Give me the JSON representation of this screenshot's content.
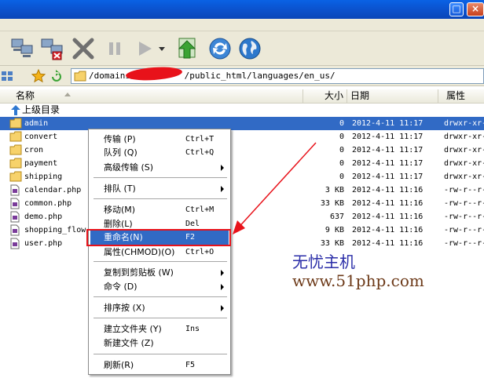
{
  "window": {
    "maximize_glyph": "□",
    "close_glyph": "×"
  },
  "toolbar": {
    "icons": [
      "connect-icon",
      "disconnect-icon",
      "cancel-icon",
      "pause-icon",
      "play-icon",
      "play-dropdown-icon",
      "transfer-icon",
      "refresh-icon",
      "globe-icon"
    ]
  },
  "address": {
    "path_prefix": "/domains/",
    "path_suffix": "/public_html/languages/en_us/"
  },
  "columns": {
    "name": "名称",
    "size": "大小",
    "date": "日期",
    "attr": "属性"
  },
  "files": [
    {
      "name": "上级目录",
      "size": "",
      "date": "",
      "attr": "",
      "type": "up"
    },
    {
      "name": "admin",
      "size": "0",
      "date": "2012-4-11 11:17",
      "attr": "drwxr-xr-x",
      "type": "folder",
      "selected": true
    },
    {
      "name": "convert",
      "size": "0",
      "date": "2012-4-11 11:17",
      "attr": "drwxr-xr-x",
      "type": "folder"
    },
    {
      "name": "cron",
      "size": "0",
      "date": "2012-4-11 11:17",
      "attr": "drwxr-xr-x",
      "type": "folder"
    },
    {
      "name": "payment",
      "size": "0",
      "date": "2012-4-11 11:17",
      "attr": "drwxr-xr-x",
      "type": "folder"
    },
    {
      "name": "shipping",
      "size": "0",
      "date": "2012-4-11 11:17",
      "attr": "drwxr-xr-x",
      "type": "folder"
    },
    {
      "name": "calendar.php",
      "size": "3 KB",
      "date": "2012-4-11 11:16",
      "attr": "-rw-r--r--",
      "type": "file"
    },
    {
      "name": "common.php",
      "size": "33 KB",
      "date": "2012-4-11 11:16",
      "attr": "-rw-r--r--",
      "type": "file"
    },
    {
      "name": "demo.php",
      "size": "637",
      "date": "2012-4-11 11:16",
      "attr": "-rw-r--r--",
      "type": "file"
    },
    {
      "name": "shopping_flow.",
      "size": "9 KB",
      "date": "2012-4-11 11:16",
      "attr": "-rw-r--r--",
      "type": "file"
    },
    {
      "name": "user.php",
      "size": "33 KB",
      "date": "2012-4-11 11:16",
      "attr": "-rw-r--r--",
      "type": "file"
    }
  ],
  "context_menu": {
    "items": [
      {
        "label": "传输 (P)",
        "shortcut": "Ctrl+T"
      },
      {
        "label": "队列 (Q)",
        "shortcut": "Ctrl+Q"
      },
      {
        "label": "高级传输 (S)",
        "shortcut": ""
      },
      {
        "label": "排队 (T)",
        "shortcut": ""
      },
      {
        "label": "移动(M)",
        "shortcut": "Ctrl+M"
      },
      {
        "label": "删除(L)",
        "shortcut": "Del"
      },
      {
        "label": "重命名(N)",
        "shortcut": "F2"
      },
      {
        "label": "属性(CHMOD)(O)",
        "shortcut": "Ctrl+O"
      },
      {
        "label": "复制到剪贴板 (W)",
        "shortcut": ""
      },
      {
        "label": "命令 (D)",
        "shortcut": ""
      },
      {
        "label": "排序按 (X)",
        "shortcut": ""
      },
      {
        "label": "建立文件夹 (Y)",
        "shortcut": "Ins"
      },
      {
        "label": "新建文件 (Z)",
        "shortcut": ""
      },
      {
        "label": "刷新(R)",
        "shortcut": "F5"
      }
    ]
  },
  "annotation": {
    "site_name": "无忧主机",
    "site_url": "www.51php.com"
  },
  "colors": {
    "selection": "#316ac5",
    "annotation_red": "#e8121a",
    "annotation_blue": "#2b2ea8",
    "annotation_brown": "#6d3a19"
  }
}
